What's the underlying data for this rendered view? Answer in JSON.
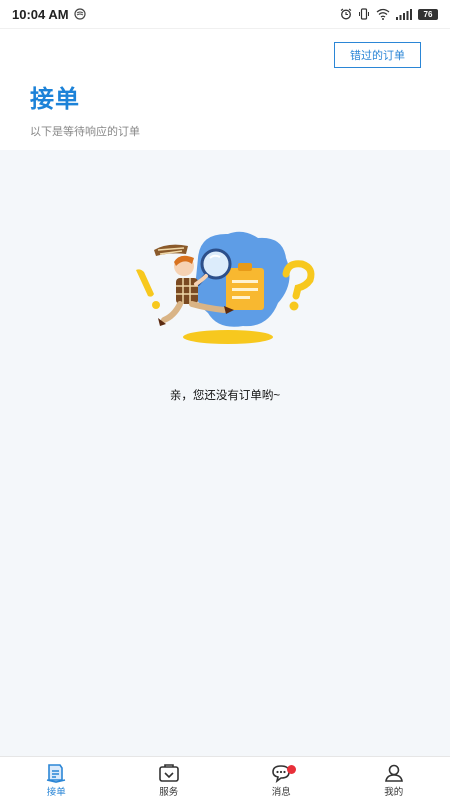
{
  "status_bar": {
    "time": "10:04 AM",
    "battery": "76"
  },
  "header": {
    "missed_orders_label": "错过的订单",
    "title": "接单",
    "subtitle": "以下是等待响应的订单"
  },
  "empty_state": {
    "message": "亲，您还没有订单哟~"
  },
  "tabs": [
    {
      "label": "接单",
      "icon": "order-icon",
      "active": true
    },
    {
      "label": "服务",
      "icon": "service-icon",
      "active": false
    },
    {
      "label": "消息",
      "icon": "message-icon",
      "active": false,
      "badge": true
    },
    {
      "label": "我的",
      "icon": "profile-icon",
      "active": false
    }
  ],
  "colors": {
    "accent": "#1c82d8",
    "content_bg": "#f4f7fa",
    "badge": "#e8303a"
  }
}
